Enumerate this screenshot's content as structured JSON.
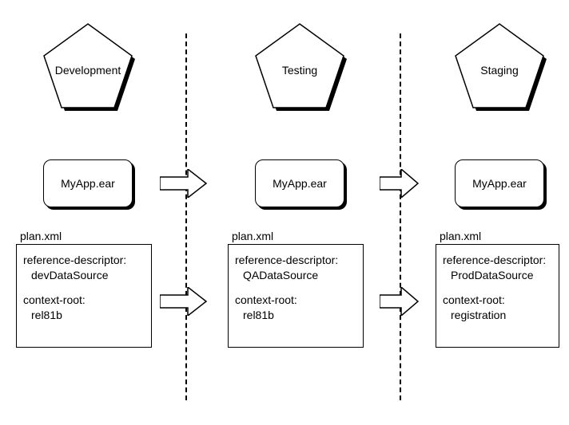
{
  "columns": [
    {
      "pentagon_label": "Development",
      "ear_label": "MyApp.ear",
      "plan_label": "plan.xml",
      "ref_key": "reference-descriptor:",
      "ref_val": "devDataSource",
      "ctx_key": "context-root:",
      "ctx_val": "rel81b"
    },
    {
      "pentagon_label": "Testing",
      "ear_label": "MyApp.ear",
      "plan_label": "plan.xml",
      "ref_key": "reference-descriptor:",
      "ref_val": "QADataSource",
      "ctx_key": "context-root:",
      "ctx_val": "rel81b"
    },
    {
      "pentagon_label": "Staging",
      "ear_label": "MyApp.ear",
      "plan_label": "plan.xml",
      "ref_key": "reference-descriptor:",
      "ref_val": "ProdDataSource",
      "ctx_key": "context-root:",
      "ctx_val": "registration"
    }
  ],
  "relationships": {
    "flow": [
      "Development",
      "Testing",
      "Staging"
    ],
    "artifact_propagates": "MyApp.ear",
    "plan_propagates": "plan.xml"
  }
}
